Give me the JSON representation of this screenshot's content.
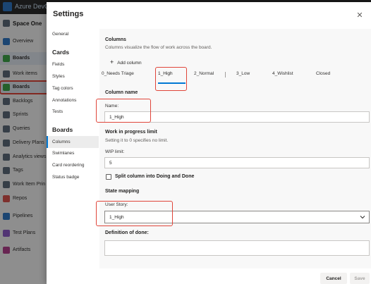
{
  "app": {
    "title": "Azure DevOps",
    "project_name": "Space One",
    "nav": [
      {
        "label": "Overview",
        "color": "#2f78c4"
      },
      {
        "label": "Boards",
        "color": "#3fa649"
      },
      {
        "label": "Work items",
        "color": "#5e6b7a"
      },
      {
        "label": "Boards",
        "color": "#3fa649"
      },
      {
        "label": "Backlogs",
        "color": "#5e6b7a"
      },
      {
        "label": "Sprints",
        "color": "#5e6b7a"
      },
      {
        "label": "Queries",
        "color": "#5e6b7a"
      },
      {
        "label": "Delivery Plans",
        "color": "#5e6b7a"
      },
      {
        "label": "Analytics views",
        "color": "#5e6b7a"
      },
      {
        "label": "Tags",
        "color": "#5e6b7a"
      },
      {
        "label": "Work Item Prin",
        "color": "#5e6b7a"
      },
      {
        "label": "Repos",
        "color": "#d9534f"
      },
      {
        "label": "Pipelines",
        "color": "#2f78c4"
      },
      {
        "label": "Test Plans",
        "color": "#8e5cc9"
      },
      {
        "label": "Artifacts",
        "color": "#b4418e"
      }
    ]
  },
  "dialog": {
    "title": "Settings",
    "close_icon": "close-icon",
    "nav": {
      "general": "General",
      "cards_heading": "Cards",
      "fields": "Fields",
      "styles": "Styles",
      "tag_colors": "Tag colors",
      "annotations": "Annotations",
      "tests": "Tests",
      "boards_heading": "Boards",
      "columns": "Columns",
      "swimlanes": "Swimlanes",
      "card_reordering": "Card reordering",
      "status_badge": "Status badge"
    },
    "columns_section": {
      "heading": "Columns",
      "description": "Columns visualize the flow of work across the board.",
      "add_column_label": "Add column",
      "tabs": [
        "0_Needs Triage",
        "1_High",
        "2_Normal",
        "3_Low",
        "4_Wishlist",
        "Closed"
      ],
      "selected_tab": "1_High"
    },
    "column_name": {
      "heading": "Column name",
      "name_label": "Name:",
      "name_value": "1_High"
    },
    "wip": {
      "heading": "Work in progress limit",
      "description": "Setting it to 0 specifies no limit.",
      "limit_label": "WIP limit:",
      "limit_value": "5",
      "split_label": "Split column into Doing and Done",
      "split_checked": false
    },
    "state_mapping": {
      "heading": "State mapping",
      "user_story_label": "User Story:",
      "user_story_value": "1_High"
    },
    "definition_of_done": {
      "label": "Definition of done:",
      "value": ""
    },
    "buttons": {
      "cancel": "Cancel",
      "save": "Save"
    }
  },
  "colors": {
    "accent": "#0078d4",
    "annotation": "#e0453a"
  }
}
